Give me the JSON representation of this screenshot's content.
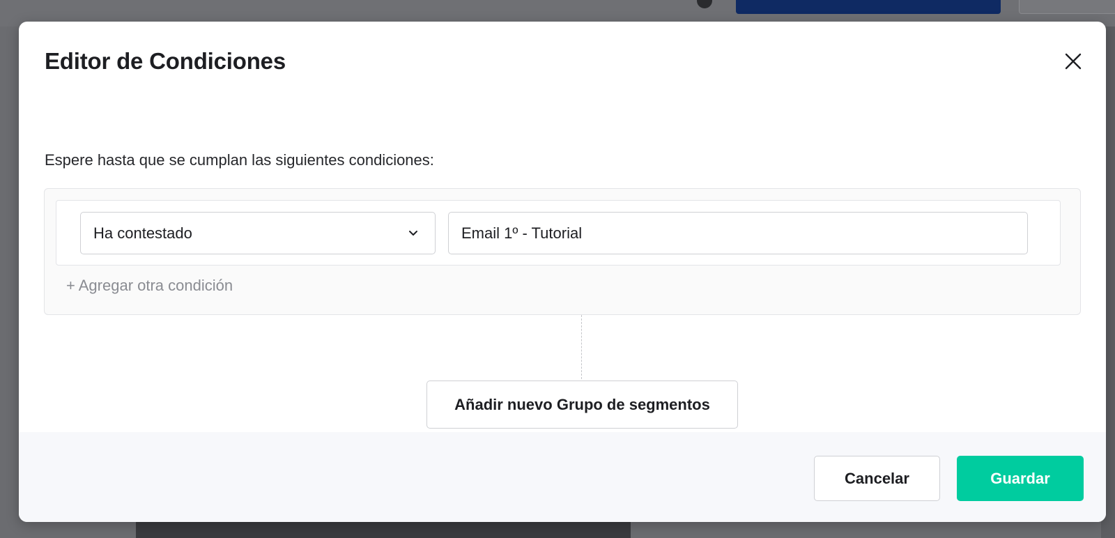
{
  "modal": {
    "title": "Editor de Condiciones",
    "close_icon": "close-icon",
    "instruction": "Espere hasta que se cumplan las siguientes condiciones:"
  },
  "condition_group": {
    "conditions": [
      {
        "operator": "Ha contestado",
        "operator_icon": "chevron-down-icon",
        "value": "Email 1º - Tutorial"
      }
    ],
    "add_condition_label": "+ Agregar otra condición"
  },
  "add_group_label": "Añadir nuevo Grupo de segmentos",
  "footer": {
    "cancel_label": "Cancelar",
    "save_label": "Guardar"
  },
  "colors": {
    "accent": "#00cc9f",
    "background_primary_button": "#0f2a63"
  }
}
